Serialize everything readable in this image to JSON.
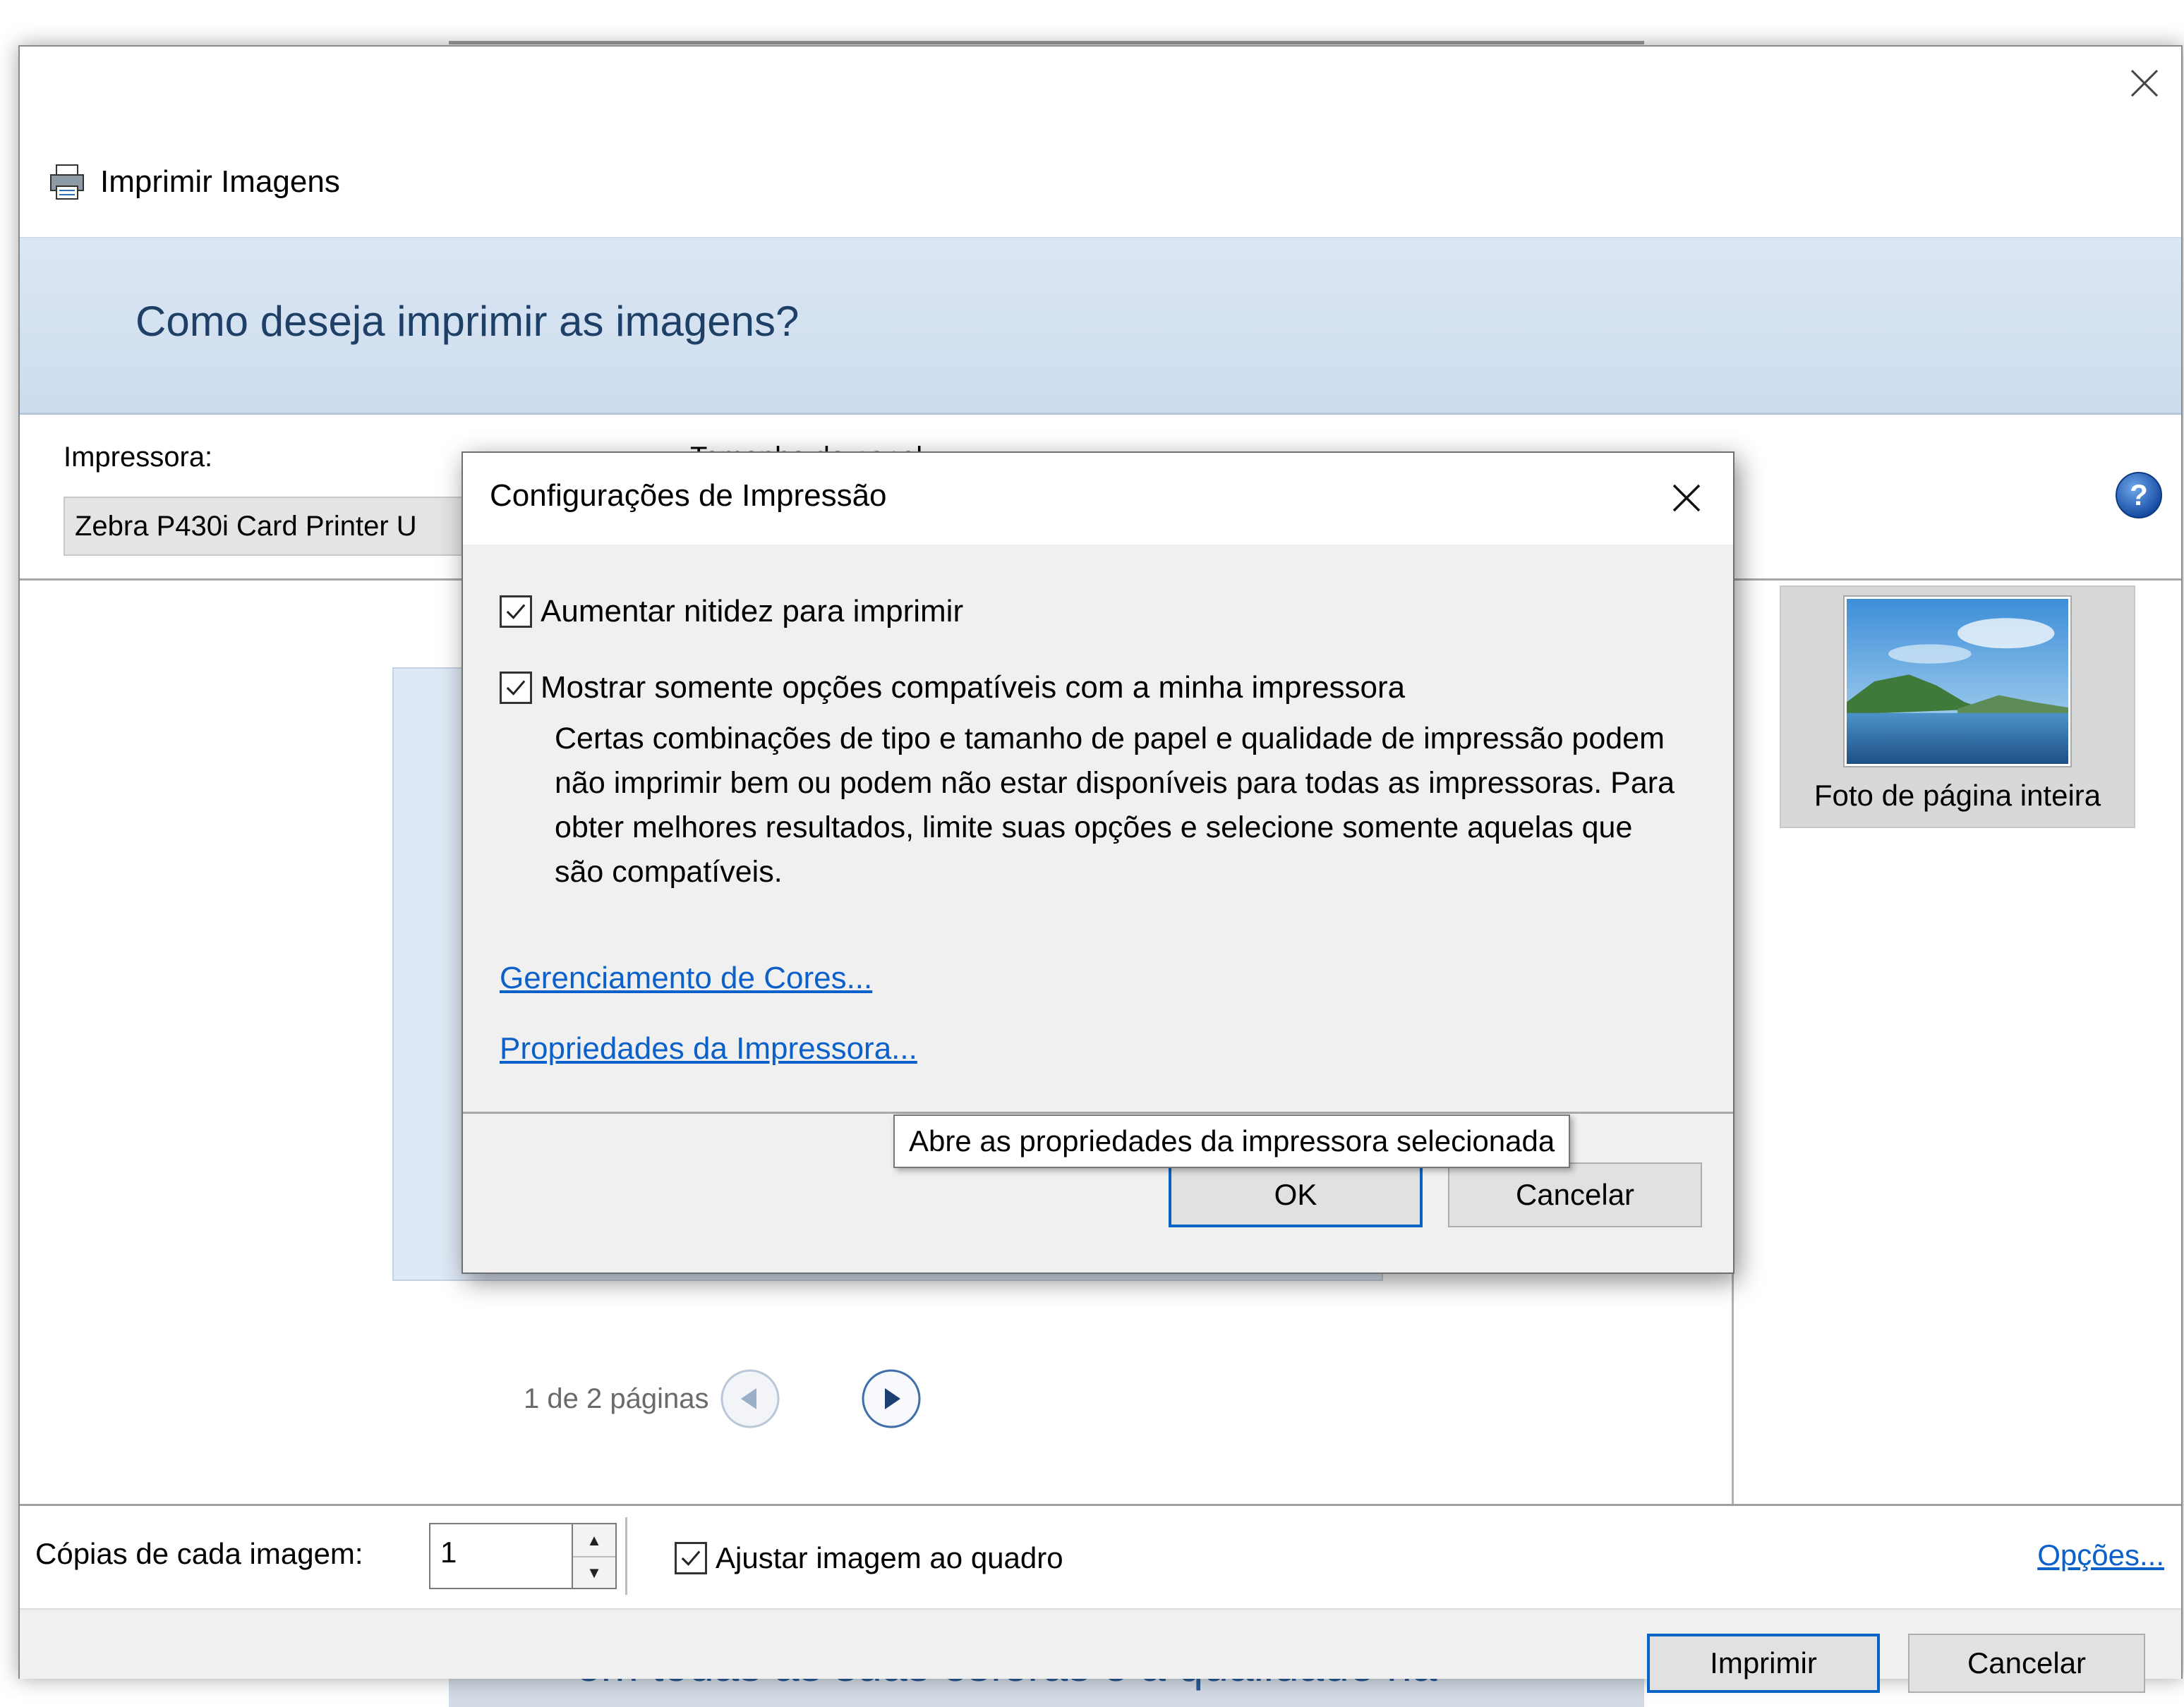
{
  "background": {
    "text_fragment": "em todas as suas esferas e a qualidade na"
  },
  "window": {
    "title": "Imprimir Imagens",
    "icon": "printer-icon"
  },
  "banner": {
    "heading": "Como deseja imprimir as imagens?"
  },
  "printer": {
    "label": "Impressora:",
    "selected": "Zebra P430i Card Printer U"
  },
  "paper": {
    "label": "Tamanho do papel:"
  },
  "pager": {
    "text": "1 de 2 páginas"
  },
  "layout": {
    "selected_label": "Foto de página inteira"
  },
  "bottom": {
    "copies_label": "Cópias de cada imagem:",
    "copies_value": "1",
    "fit_label": "Ajustar imagem ao quadro",
    "fit_checked": true,
    "options_link": "Opções..."
  },
  "footer": {
    "print_label": "Imprimir",
    "cancel_label": "Cancelar"
  },
  "dialog": {
    "title": "Configurações de Impressão",
    "checkbox1": {
      "label": "Aumentar nitidez para imprimir",
      "checked": true
    },
    "checkbox2": {
      "label": "Mostrar somente opções compatíveis com a minha impressora",
      "checked": true
    },
    "description": "Certas combinações de tipo e tamanho de papel e qualidade de impressão podem não imprimir bem ou podem não estar disponíveis para todas as impressoras. Para obter melhores resultados, limite suas opções e selecione somente aquelas que são compatíveis.",
    "link_color": "Gerenciamento de Cores...",
    "link_props": "Propriedades da Impressora...",
    "ok_label": "OK",
    "cancel_label": "Cancelar"
  },
  "tooltip": {
    "text": "Abre as propriedades da impressora selecionada"
  },
  "colors": {
    "accent": "#0a64c8",
    "link": "#0b60c9",
    "banner": "#dbe6f3",
    "heading": "#1e3f66"
  }
}
